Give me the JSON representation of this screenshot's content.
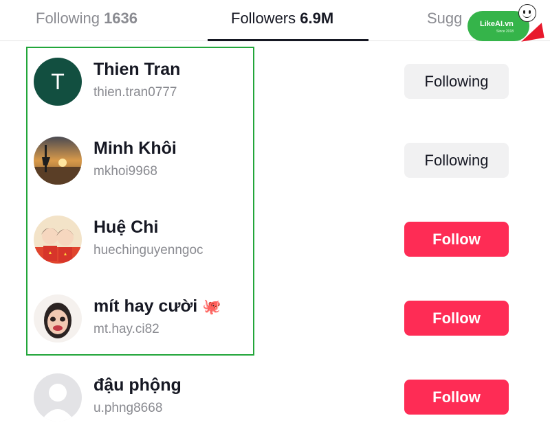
{
  "tabs": {
    "following_label": "Following",
    "following_count": "1636",
    "followers_label": "Followers",
    "followers_count": "6.9M",
    "suggested_label": "Sugg"
  },
  "logo": {
    "text": "LikeAI.vn",
    "small_text": "Since 2018"
  },
  "users": [
    {
      "name": "Thien Tran",
      "handle": "thien.tran0777",
      "button": "Following",
      "avatar_letter": "T"
    },
    {
      "name": "Minh Khôi",
      "handle": "mkhoi9968",
      "button": "Following"
    },
    {
      "name": "Huệ Chi",
      "handle": "huechinguyenngoc",
      "button": "Follow"
    },
    {
      "name": "mít hay cười",
      "name_emoji": "🐙",
      "handle": "mt.hay.ci82",
      "button": "Follow"
    },
    {
      "name": "đậu phộng",
      "handle": "u.phng8668",
      "button": "Follow"
    }
  ],
  "colors": {
    "follow_button": "#fe2c55",
    "following_button": "#f1f1f2",
    "highlight_border": "#22a63a",
    "logo_green": "#35b44a"
  }
}
